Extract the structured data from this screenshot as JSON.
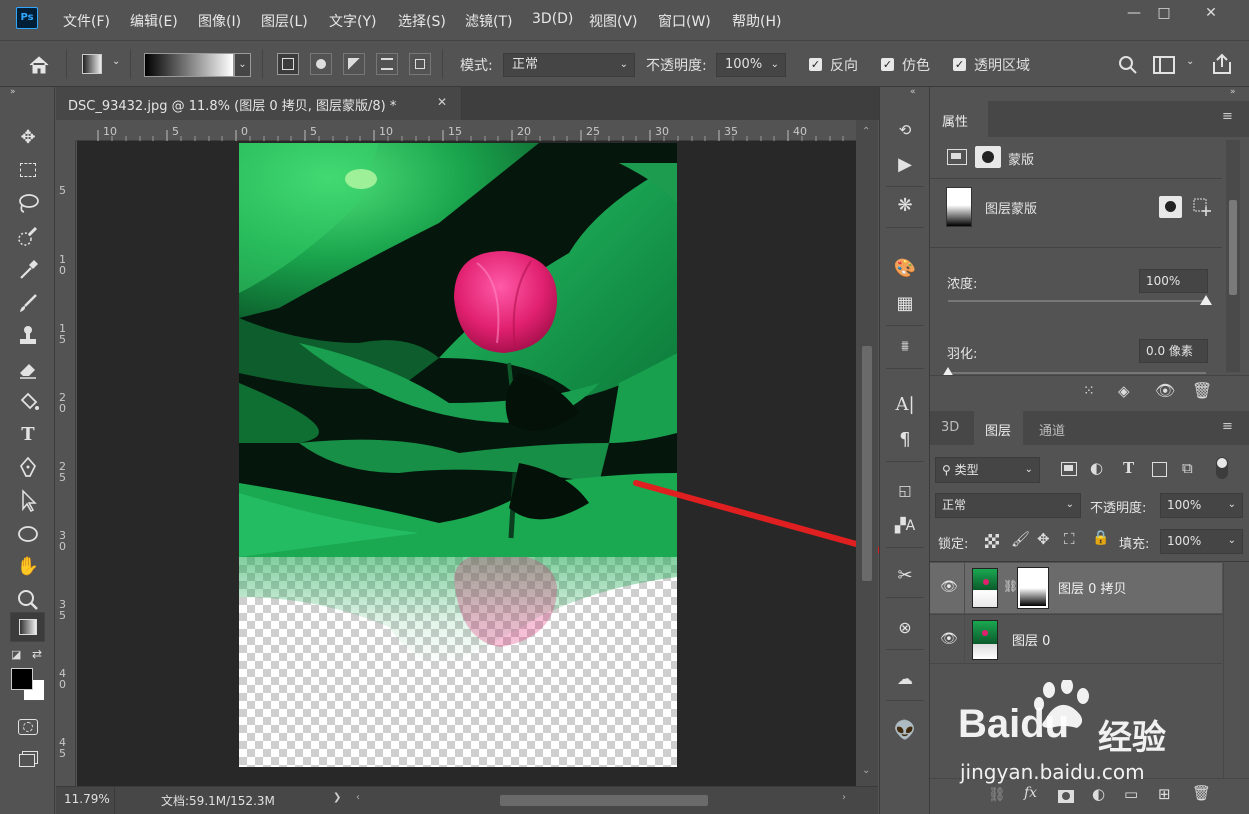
{
  "app": {
    "logo": "Ps"
  },
  "menu": [
    "文件(F)",
    "编辑(E)",
    "图像(I)",
    "图层(L)",
    "文字(Y)",
    "选择(S)",
    "滤镜(T)",
    "3D(D)",
    "视图(V)",
    "窗口(W)",
    "帮助(H)"
  ],
  "window_controls": {
    "minimize": "—",
    "maximize": "□",
    "close": "✕"
  },
  "options": {
    "mode_label": "模式:",
    "mode_value": "正常",
    "opacity_label": "不透明度:",
    "opacity_value": "100%",
    "reverse_label": "反向",
    "dither_label": "仿色",
    "transparency_label": "透明区域",
    "checked": "✓"
  },
  "document": {
    "tab_title": "DSC_93432.jpg @ 11.8% (图层 0 拷贝, 图层蒙版/8) *",
    "close": "✕",
    "ruler_h": [
      "10",
      "5",
      "0",
      "5",
      "10",
      "15",
      "20",
      "25",
      "30",
      "35",
      "40"
    ],
    "ruler_v": [
      "5",
      "1\n0",
      "1\n5",
      "2\n0",
      "2\n5",
      "3\n0",
      "3\n5",
      "4\n0",
      "4\n5"
    ],
    "zoom": "11.79%",
    "doc_info": "文档:59.1M/152.3M",
    "arrow_right": "❯"
  },
  "properties": {
    "tab": "属性",
    "mask_label": "蒙版",
    "layer_mask_label": "图层蒙版",
    "density_label": "浓度:",
    "density_value": "100%",
    "feather_label": "羽化:",
    "feather_value": "0.0 像素"
  },
  "layers_panel": {
    "tabs": [
      "3D",
      "图层",
      "通道"
    ],
    "filter_label": "类型",
    "blend_mode": "正常",
    "opacity_label": "不透明度:",
    "opacity_value": "100%",
    "lock_label": "锁定:",
    "fill_label": "填充:",
    "fill_value": "100%",
    "layers": [
      {
        "name": "图层 0 拷贝",
        "selected": true
      },
      {
        "name": "图层 0",
        "selected": false
      }
    ],
    "fx": "fx"
  },
  "watermark": {
    "brand": "Baidu",
    "product": "经验",
    "url": "jingyan.baidu.com"
  },
  "colors": {
    "accent": "#31a8ff",
    "arrow": "#e02020"
  }
}
